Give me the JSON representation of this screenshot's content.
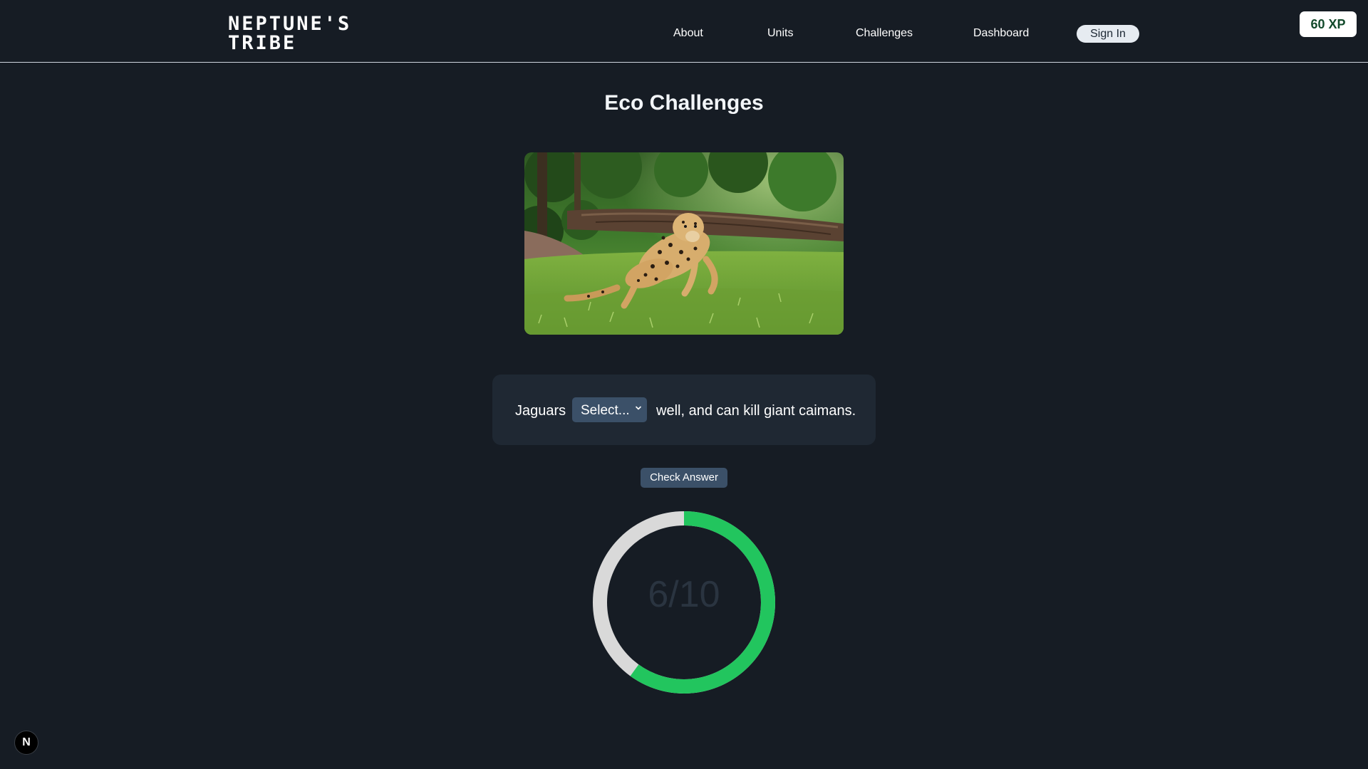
{
  "header": {
    "logo_line1": "NEPTUNE'S",
    "logo_line2": "TRIBE",
    "nav": [
      {
        "label": "About"
      },
      {
        "label": "Units"
      },
      {
        "label": "Challenges"
      },
      {
        "label": "Dashboard"
      }
    ],
    "sign_in_label": "Sign In",
    "xp_label": "60 XP"
  },
  "main": {
    "title": "Eco Challenges",
    "question": {
      "prefix": "Jaguars",
      "select_value": "Select...",
      "suffix": "well, and can kill giant caimans."
    },
    "check_button_label": "Check Answer",
    "progress": {
      "label": "6/10",
      "current": 6,
      "total": 10,
      "fill_color": "#22c55e",
      "track_color": "#d9d9d9"
    }
  },
  "corner_badge_label": "N",
  "icons": {
    "select_chevron": "chevron-down-icon",
    "photo": "cheetah-photo"
  }
}
